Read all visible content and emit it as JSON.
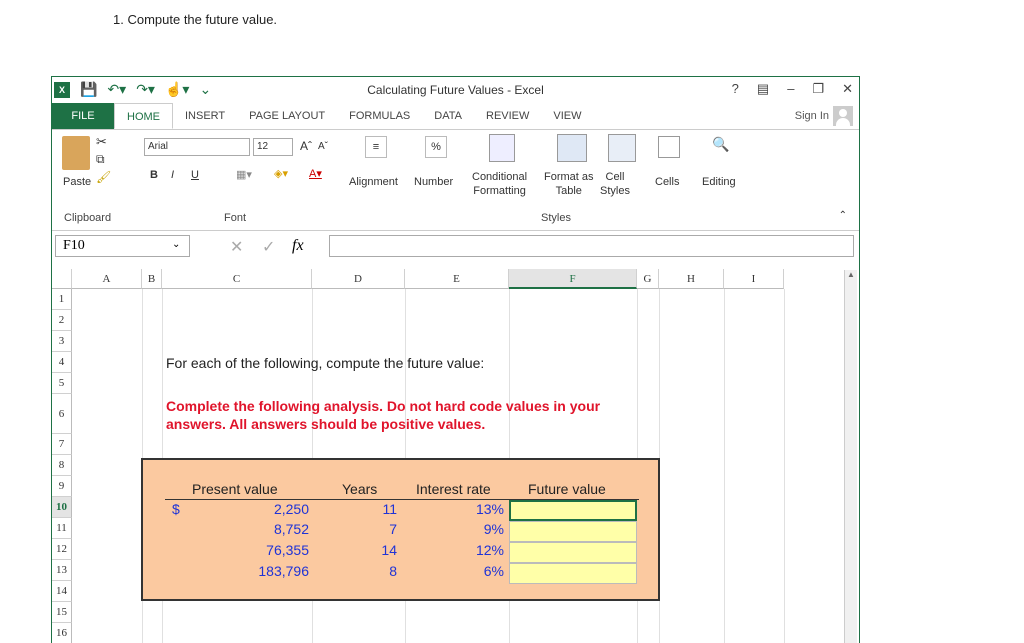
{
  "question": "1. Compute the future value.",
  "window": {
    "title": "Calculating Future Values - Excel",
    "controls": [
      "?",
      "restore-ribbon",
      "minimize",
      "restore",
      "close"
    ],
    "sign_in": "Sign In"
  },
  "tabs": [
    "FILE",
    "HOME",
    "INSERT",
    "PAGE LAYOUT",
    "FORMULAS",
    "DATA",
    "REVIEW",
    "VIEW"
  ],
  "ribbon": {
    "paste": "Paste",
    "clipboard": "Clipboard",
    "font_name": "Arial",
    "font_size": "12",
    "font_group": "Font",
    "bold": "B",
    "italic": "I",
    "underline": "U",
    "alignment": "Alignment",
    "number": "Number",
    "percent": "%",
    "conditional_1": "Conditional",
    "conditional_2": "Formatting",
    "format_table_1": "Format as",
    "format_table_2": "Table",
    "cell_styles_1": "Cell",
    "cell_styles_2": "Styles",
    "styles_group": "Styles",
    "cells": "Cells",
    "editing": "Editing"
  },
  "formula_bar": {
    "name_box": "F10",
    "fx": "fx",
    "value": ""
  },
  "columns": [
    "A",
    "B",
    "C",
    "D",
    "E",
    "F",
    "G",
    "H",
    "I"
  ],
  "rows": [
    "1",
    "2",
    "3",
    "4",
    "5",
    "6",
    "7",
    "8",
    "9",
    "10",
    "11",
    "12",
    "13",
    "14",
    "15",
    "16"
  ],
  "sheet": {
    "instruction": "For each of the following, compute the future value:",
    "warning": "Complete the following analysis. Do not hard code values in your answers. All answers should be positive values.",
    "headers": [
      "Present value",
      "Years",
      "Interest rate",
      "Future value"
    ],
    "currency_symbol": "$",
    "table": [
      {
        "present_value": "2,250",
        "years": "11",
        "rate": "13%",
        "future_value": ""
      },
      {
        "present_value": "8,752",
        "years": "7",
        "rate": "9%",
        "future_value": ""
      },
      {
        "present_value": "76,355",
        "years": "14",
        "rate": "12%",
        "future_value": ""
      },
      {
        "present_value": "183,796",
        "years": "8",
        "rate": "6%",
        "future_value": ""
      }
    ]
  },
  "colors": {
    "excel_green": "#1e7145",
    "warning_red": "#e0142b",
    "input_blue": "#1f33d6",
    "box_fill": "#fbc9a0",
    "answer_fill": "#ffffa8"
  }
}
